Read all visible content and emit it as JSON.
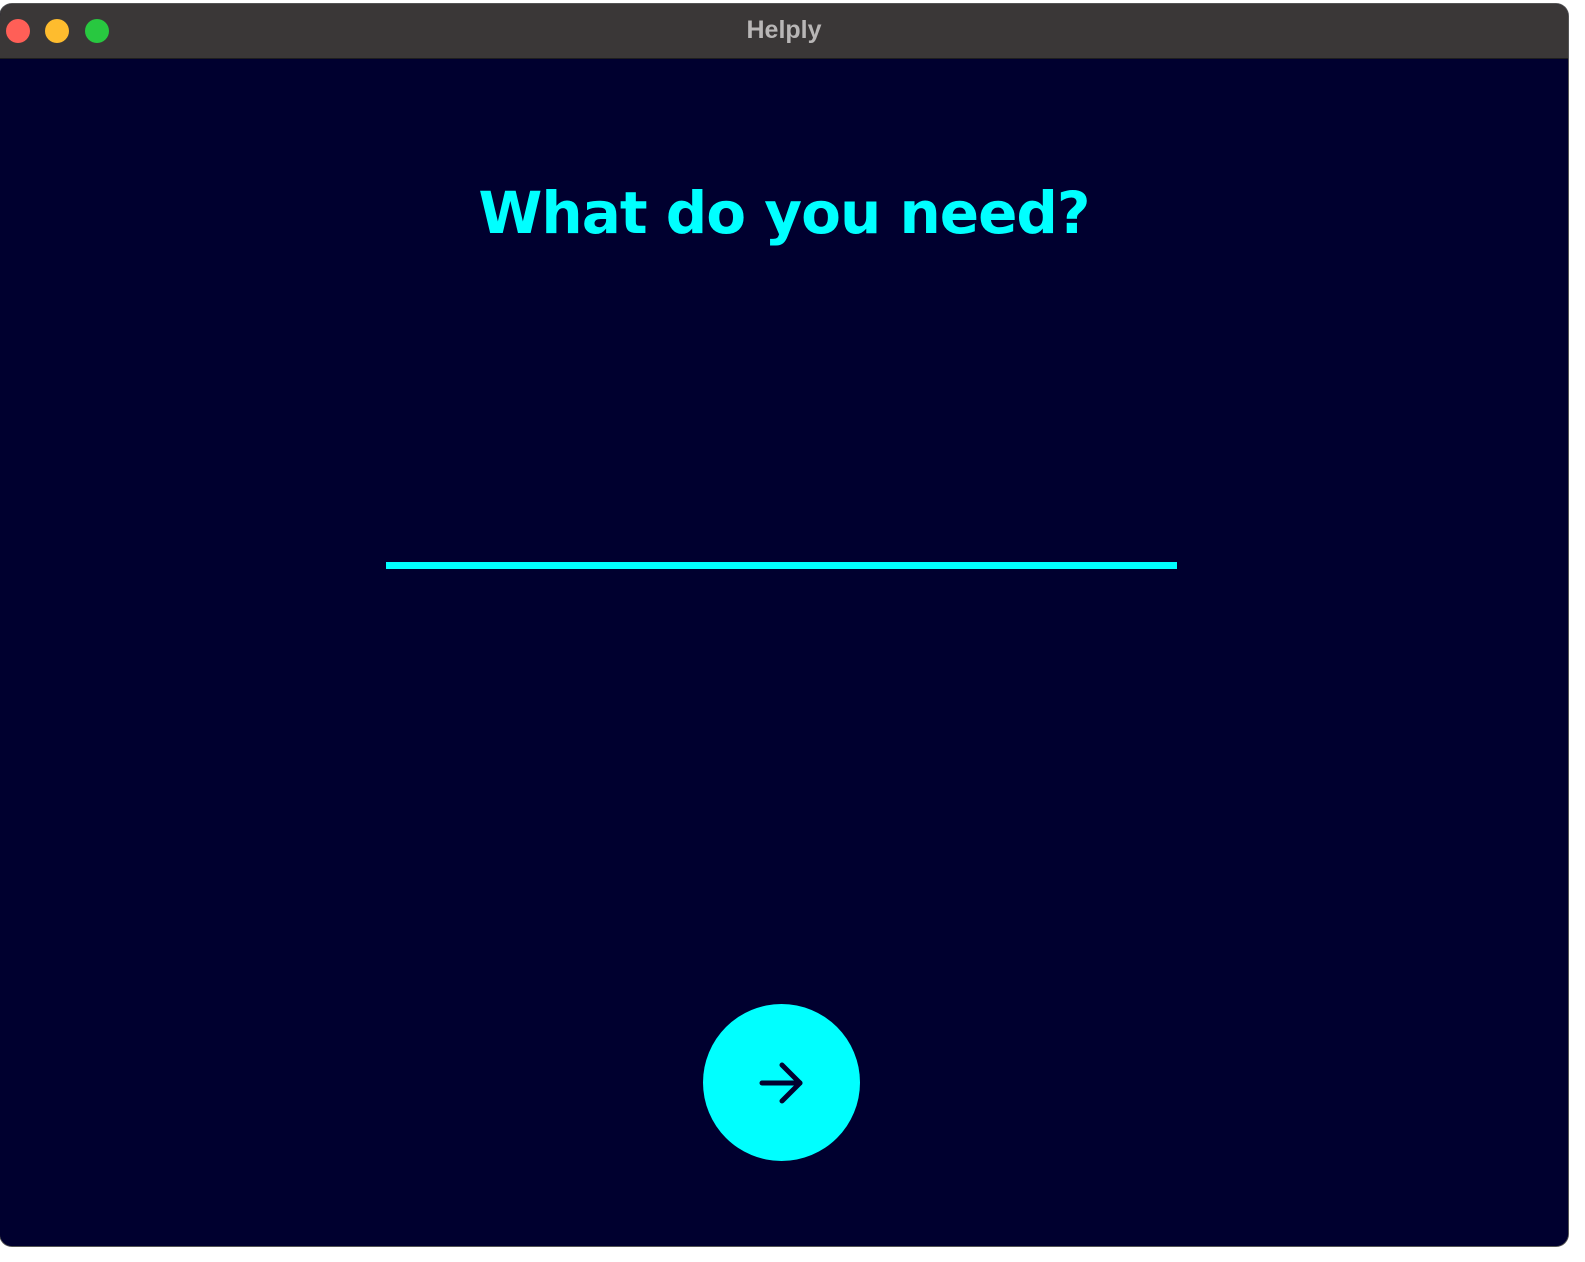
{
  "window": {
    "title": "Helply"
  },
  "main": {
    "heading": "What do you need?",
    "input_value": "",
    "next_button_icon": "arrow-right-icon"
  },
  "colors": {
    "background": "#00002f",
    "accent": "#00ffff",
    "titlebar": "#3a3737"
  }
}
